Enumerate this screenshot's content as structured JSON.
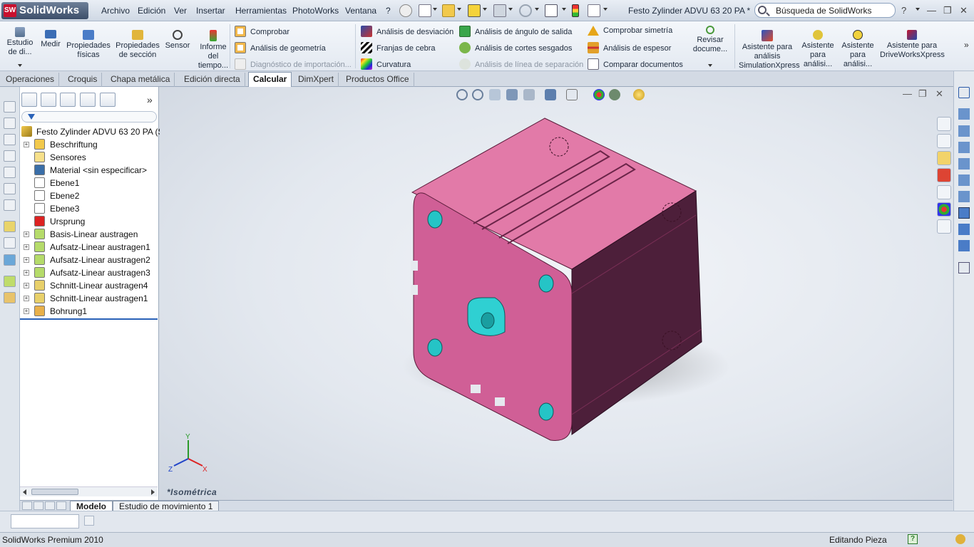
{
  "app": {
    "logo_text": "SolidWorks",
    "document_title": "Festo Zylinder ADVU 63 20 PA *"
  },
  "menu": [
    "Archivo",
    "Edición",
    "Ver",
    "Insertar",
    "Herramientas",
    "PhotoWorks",
    "Ventana",
    "?"
  ],
  "search": {
    "placeholder": "Búsqueda de SolidWorks"
  },
  "ribbon": {
    "large_buttons": [
      {
        "label": "Estudio de di...",
        "icon": "design-study-icon"
      },
      {
        "label": "Medir",
        "icon": "measure-icon"
      },
      {
        "label": "Propiedades físicas",
        "icon": "mass-properties-icon"
      },
      {
        "label": "Propiedades de sección",
        "icon": "section-properties-icon"
      },
      {
        "label": "Sensor",
        "icon": "sensor-icon"
      },
      {
        "label": "Informe del tiempo...",
        "icon": "statistics-icon"
      }
    ],
    "col1": [
      {
        "label": "Comprobar",
        "icon": "check-icon",
        "enabled": true
      },
      {
        "label": "Análisis de geometría",
        "icon": "geometry-analysis-icon",
        "enabled": true
      },
      {
        "label": "Diagnóstico de importación...",
        "icon": "import-diagnostics-icon",
        "enabled": false
      }
    ],
    "col2": [
      {
        "label": "Análisis de desviación",
        "icon": "deviation-icon",
        "enabled": true
      },
      {
        "label": "Franjas de cebra",
        "icon": "zebra-icon",
        "enabled": true
      },
      {
        "label": "Curvatura",
        "icon": "curvature-icon",
        "enabled": true
      }
    ],
    "col3": [
      {
        "label": "Análisis de ángulo de salida",
        "icon": "draft-analysis-icon",
        "enabled": true
      },
      {
        "label": "Análisis de cortes sesgados",
        "icon": "undercut-icon",
        "enabled": true
      },
      {
        "label": "Análisis de línea de separación",
        "icon": "parting-line-icon",
        "enabled": false
      }
    ],
    "col4": [
      {
        "label": "Comprobar simetría",
        "icon": "symmetry-icon",
        "enabled": true
      },
      {
        "label": "Análisis de espesor",
        "icon": "thickness-icon",
        "enabled": true
      },
      {
        "label": "Comparar documentos",
        "icon": "compare-icon",
        "enabled": true
      }
    ],
    "review": {
      "label": "Revisar docume...",
      "icon": "review-icon"
    },
    "assistants": [
      {
        "label": "Asistente para análisis SimulationXpress",
        "icon": "simulationxpress-icon"
      },
      {
        "label": "Asistente para análisi...",
        "icon": "floxpress-icon"
      },
      {
        "label": "Asistente para análisi...",
        "icon": "dfmxpress-icon"
      },
      {
        "label": "Asistente para DriveWorksXpress",
        "icon": "driveworks-icon"
      }
    ]
  },
  "tabs": [
    {
      "label": "Operaciones",
      "active": false
    },
    {
      "label": "Croquis",
      "active": false
    },
    {
      "label": "Chapa metálica",
      "active": false
    },
    {
      "label": "Edición directa",
      "active": false
    },
    {
      "label": "Calcular",
      "active": true
    },
    {
      "label": "DimXpert",
      "active": false
    },
    {
      "label": "Productos Office",
      "active": false
    }
  ],
  "feature_tree": {
    "root": "Festo Zylinder ADVU 63 20 PA  (S",
    "items": [
      {
        "label": "Beschriftung",
        "icon": "annotations-icon",
        "expandable": true
      },
      {
        "label": "Sensores",
        "icon": "sensors-icon",
        "expandable": false
      },
      {
        "label": "Material <sin especificar>",
        "icon": "material-icon",
        "expandable": false
      },
      {
        "label": "Ebene1",
        "icon": "plane-icon",
        "expandable": false
      },
      {
        "label": "Ebene2",
        "icon": "plane-icon",
        "expandable": false
      },
      {
        "label": "Ebene3",
        "icon": "plane-icon",
        "expandable": false
      },
      {
        "label": "Ursprung",
        "icon": "origin-icon",
        "expandable": false
      },
      {
        "label": "Basis-Linear austragen",
        "icon": "extrude-icon",
        "expandable": true
      },
      {
        "label": "Aufsatz-Linear austragen1",
        "icon": "extrude-icon",
        "expandable": true
      },
      {
        "label": "Aufsatz-Linear austragen2",
        "icon": "extrude-icon",
        "expandable": true
      },
      {
        "label": "Aufsatz-Linear austragen3",
        "icon": "extrude-icon",
        "expandable": true
      },
      {
        "label": "Schnitt-Linear austragen4",
        "icon": "cut-extrude-icon",
        "expandable": true
      },
      {
        "label": "Schnitt-Linear austragen1",
        "icon": "cut-extrude-icon",
        "expandable": true
      },
      {
        "label": "Bohrung1",
        "icon": "hole-icon",
        "expandable": true
      }
    ]
  },
  "viewport": {
    "view_label": "*Isométrica",
    "triad": {
      "x": "X",
      "y": "Y",
      "z": "Z"
    },
    "part_color": "#d8689a",
    "accent_color": "#2bc8c8"
  },
  "bottom_tabs": [
    {
      "label": "Modelo",
      "active": true
    },
    {
      "label": "Estudio de movimiento 1",
      "active": false
    }
  ],
  "status": {
    "left": "SolidWorks Premium 2010",
    "right": "Editando Pieza"
  }
}
